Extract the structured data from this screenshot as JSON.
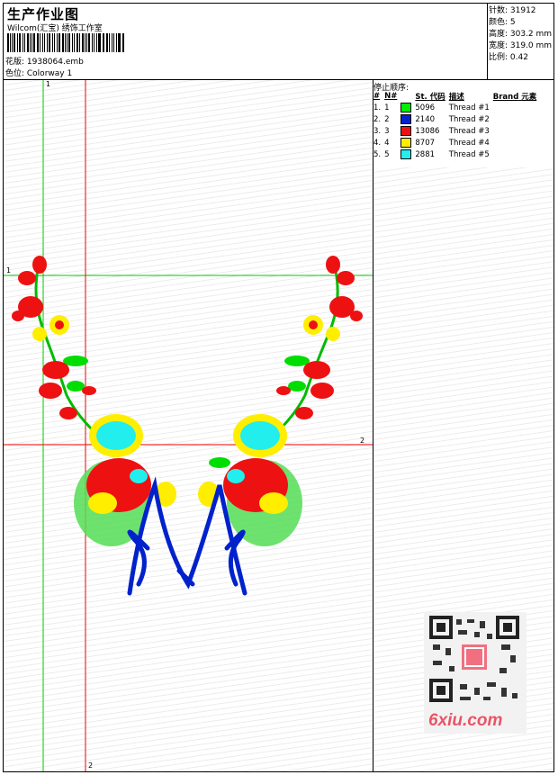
{
  "header": {
    "title": "生产作业图",
    "subtitle": "Wilcom(汇宝) 绣饰工作室",
    "design_label": "花版: 1938064.emb",
    "colorway_label": "色位: Colorway 1"
  },
  "stats": {
    "stitches": "针数: 31912",
    "colors": "颜色: 5",
    "height": "高度: 303.2 mm",
    "width": "宽度: 319.0 mm",
    "scale": "比例: 0.42"
  },
  "stop_sequence": {
    "title": "停止顺序:",
    "headers": [
      "#",
      "N#",
      "St.",
      "代码",
      "描述",
      "Brand",
      "元素"
    ],
    "rows": [
      {
        "idx": "1.",
        "n": "1",
        "color": "#00ee00",
        "code": "5096",
        "desc": "Thread #1"
      },
      {
        "idx": "2.",
        "n": "2",
        "color": "#0022cc",
        "code": "2140",
        "desc": "Thread #2"
      },
      {
        "idx": "3.",
        "n": "3",
        "color": "#ee1111",
        "code": "13086",
        "desc": "Thread #3"
      },
      {
        "idx": "4.",
        "n": "4",
        "color": "#ffee00",
        "code": "8707",
        "desc": "Thread #4"
      },
      {
        "idx": "5.",
        "n": "5",
        "color": "#22eeee",
        "code": "2881",
        "desc": "Thread #5"
      }
    ]
  },
  "guides": {
    "g1_top": "1",
    "g1_left": "1",
    "g2_right": "2",
    "g2_bottom": "2"
  },
  "watermark": {
    "logo_text": "6xiu.com"
  }
}
